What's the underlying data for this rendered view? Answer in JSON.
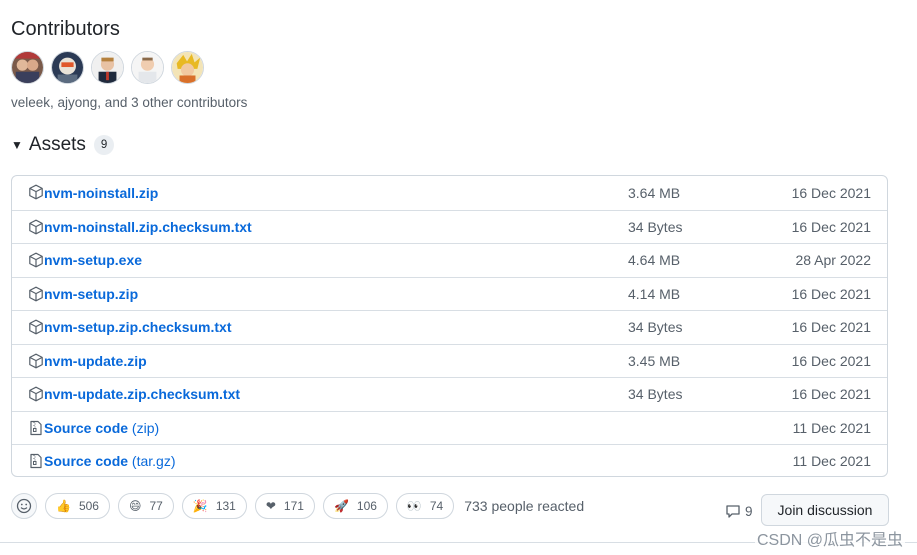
{
  "contributors": {
    "title": "Contributors",
    "summary": "veleek, ajyong, and 3 other contributors"
  },
  "assets": {
    "title": "Assets",
    "count": "9",
    "rows": [
      {
        "name": "nvm-noinstall.zip",
        "size": "3.64 MB",
        "date": "16 Dec 2021",
        "icon": "package-icon"
      },
      {
        "name": "nvm-noinstall.zip.checksum.txt",
        "size": "34 Bytes",
        "date": "16 Dec 2021",
        "icon": "package-icon"
      },
      {
        "name": "nvm-setup.exe",
        "size": "4.64 MB",
        "date": "28 Apr 2022",
        "icon": "package-icon"
      },
      {
        "name": "nvm-setup.zip",
        "size": "4.14 MB",
        "date": "16 Dec 2021",
        "icon": "package-icon"
      },
      {
        "name": "nvm-setup.zip.checksum.txt",
        "size": "34 Bytes",
        "date": "16 Dec 2021",
        "icon": "package-icon"
      },
      {
        "name": "nvm-update.zip",
        "size": "3.45 MB",
        "date": "16 Dec 2021",
        "icon": "package-icon"
      },
      {
        "name": "nvm-update.zip.checksum.txt",
        "size": "34 Bytes",
        "date": "16 Dec 2021",
        "icon": "package-icon"
      },
      {
        "name": "Source code",
        "suffix": "(zip)",
        "size": "",
        "date": "11 Dec 2021",
        "icon": "file-zip-icon"
      },
      {
        "name": "Source code",
        "suffix": "(tar.gz)",
        "size": "",
        "date": "11 Dec 2021",
        "icon": "file-zip-icon"
      }
    ]
  },
  "reactions": {
    "items": [
      {
        "emoji": "👍",
        "count": "506"
      },
      {
        "emoji": "😄",
        "count": "77"
      },
      {
        "emoji": "🎉",
        "count": "131"
      },
      {
        "emoji": "❤",
        "count": "171"
      },
      {
        "emoji": "🚀",
        "count": "106"
      },
      {
        "emoji": "👀",
        "count": "74"
      }
    ],
    "summary": "733 people reacted"
  },
  "discussion": {
    "comment_count": "9",
    "join_label": "Join discussion"
  },
  "watermark": "CSDN @瓜虫不是虫",
  "colors": {
    "link": "#0969da",
    "muted": "#57606a",
    "border": "#d0d7de"
  }
}
